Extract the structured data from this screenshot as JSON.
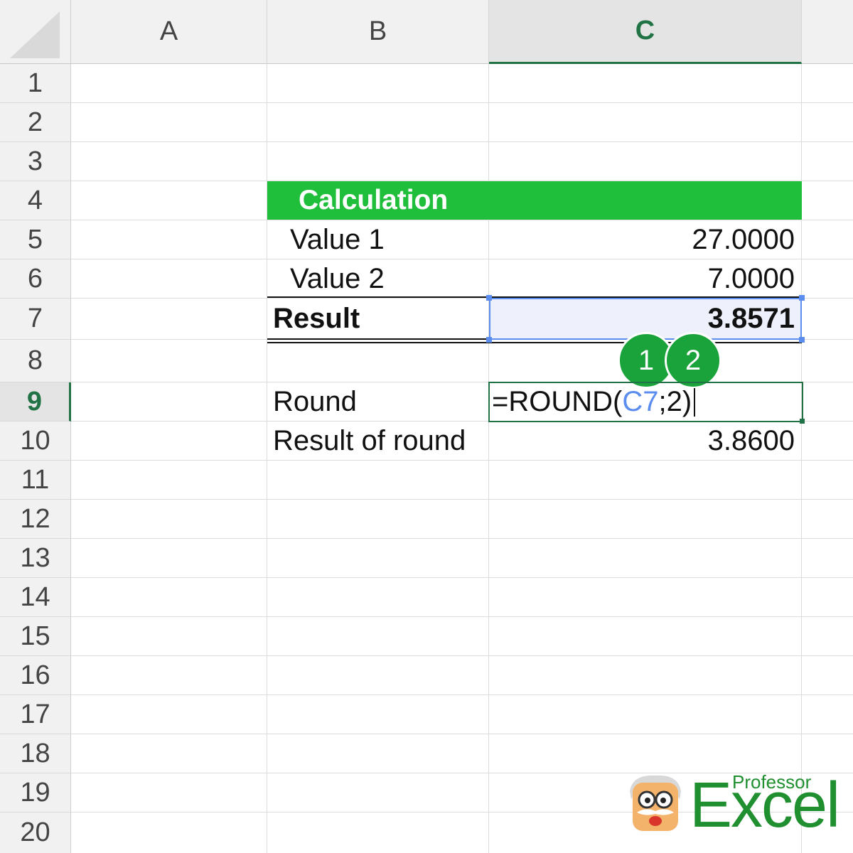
{
  "columns": [
    "A",
    "B",
    "C"
  ],
  "selected_column": "C",
  "rows": [
    "1",
    "2",
    "3",
    "4",
    "5",
    "6",
    "7",
    "8",
    "9",
    "10",
    "11",
    "12",
    "13",
    "14",
    "15",
    "16",
    "17",
    "18",
    "19",
    "20"
  ],
  "selected_row": "9",
  "table": {
    "header": "Calculation",
    "value1_label": "Value 1",
    "value1": "27.0000",
    "value2_label": "Value 2",
    "value2": "7.0000",
    "result_label": "Result",
    "result": "3.8571",
    "round_label": "Round",
    "result_of_round_label": "Result of round",
    "result_of_round": "3.8600"
  },
  "formula": {
    "prefix": "=ROUND(",
    "ref": "C7",
    "suffix": ";2)"
  },
  "badges": [
    "1",
    "2"
  ],
  "logo": {
    "top_text": "Professor",
    "main_text": "Excel"
  },
  "colors": {
    "header_green": "#1fbf3c",
    "selection_blue": "#5b8def",
    "active_green": "#217346",
    "badge_green": "#1aa33a",
    "formula_ref_blue": "#5b8def",
    "logo_green": "#1f8f2f"
  }
}
